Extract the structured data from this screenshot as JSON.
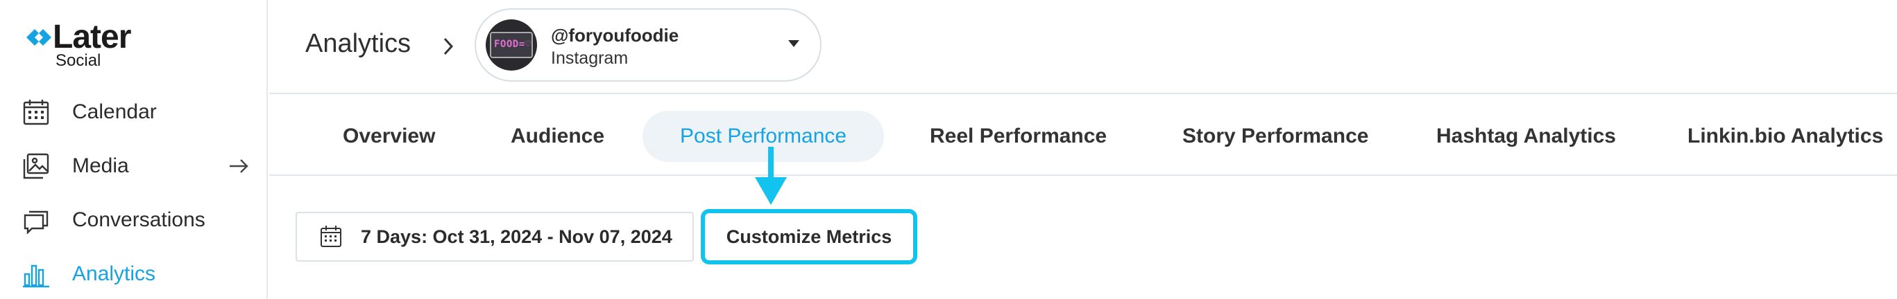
{
  "brand": {
    "name": "Later",
    "product": "Social",
    "accent": "#16a3e3",
    "logo_icon": "later-logo-icon"
  },
  "sidebar": {
    "items": [
      {
        "label": "Calendar",
        "icon": "calendar-icon",
        "active": false
      },
      {
        "label": "Media",
        "icon": "image-icon",
        "active": false,
        "trailing_icon": "arrow-right-icon"
      },
      {
        "label": "Conversations",
        "icon": "chat-icon",
        "active": false
      },
      {
        "label": "Analytics",
        "icon": "bar-chart-icon",
        "active": true
      }
    ]
  },
  "header": {
    "title": "Analytics",
    "account": {
      "handle": "@foryoufoodie",
      "network": "Instagram",
      "avatar_text": "FOOD=♡"
    }
  },
  "tabs": [
    {
      "label": "Overview",
      "active": false
    },
    {
      "label": "Audience",
      "active": false
    },
    {
      "label": "Post Performance",
      "active": true
    },
    {
      "label": "Reel Performance",
      "active": false
    },
    {
      "label": "Story Performance",
      "active": false
    },
    {
      "label": "Hashtag Analytics",
      "active": false
    },
    {
      "label": "Linkin.bio Analytics",
      "active": false
    }
  ],
  "toolbar": {
    "date_range_label": "7 Days: Oct 31, 2024 - Nov 07, 2024",
    "customize_label": "Customize Metrics",
    "highlight_color": "#11c3ee"
  }
}
